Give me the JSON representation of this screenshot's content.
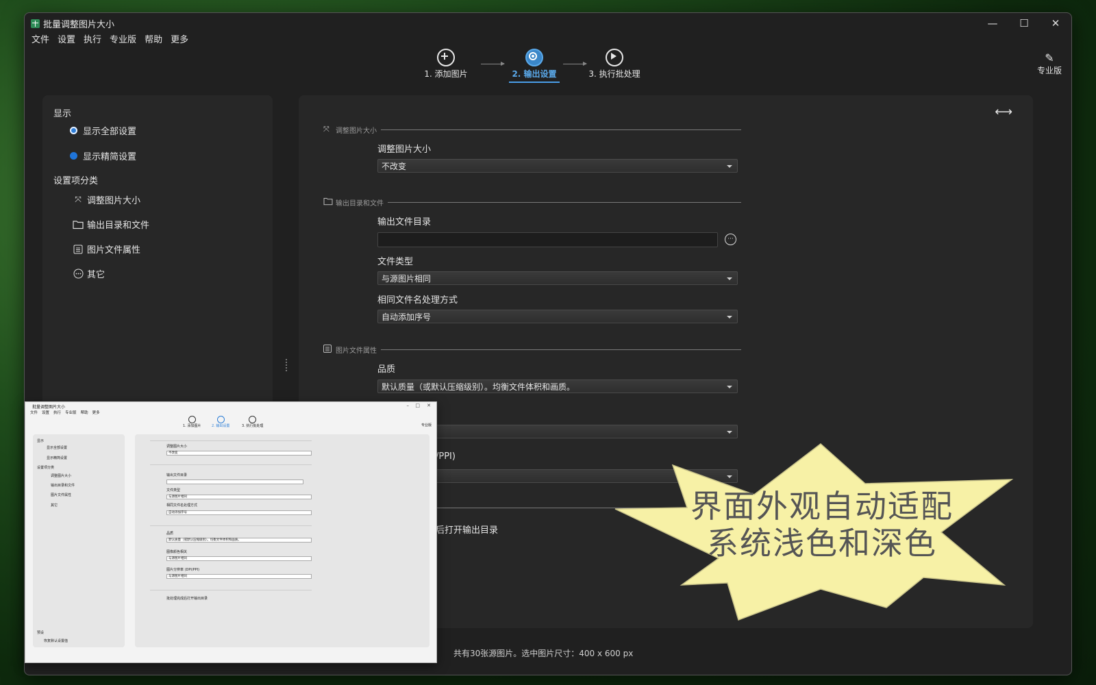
{
  "window": {
    "title": "批量调整图片大小",
    "controls": {
      "minimize": "—",
      "maximize": "☐",
      "close": "✕"
    }
  },
  "menu": [
    "文件",
    "设置",
    "执行",
    "专业版",
    "帮助",
    "更多"
  ],
  "steps": [
    {
      "label": "1. 添加图片",
      "icon": "plus-circle-icon"
    },
    {
      "label": "2. 输出设置",
      "icon": "gear-circle-icon",
      "active": true
    },
    {
      "label": "3. 执行批处理",
      "icon": "play-circle-icon"
    }
  ],
  "pro": {
    "label": "专业版",
    "icon": "pen-icon"
  },
  "sidebar": {
    "display_heading": "显示",
    "radios": [
      {
        "label": "显示全部设置",
        "selected": true
      },
      {
        "label": "显示精简设置",
        "selected": false
      }
    ],
    "category_heading": "设置项分类",
    "categories": [
      {
        "label": "调整图片大小",
        "icon": "resize-icon"
      },
      {
        "label": "输出目录和文件",
        "icon": "folder-icon"
      },
      {
        "label": "图片文件属性",
        "icon": "list-icon"
      },
      {
        "label": "其它",
        "icon": "more-circle-icon"
      }
    ]
  },
  "main": {
    "sections": [
      {
        "title": "调整图片大小",
        "icon": "resize-icon"
      },
      {
        "title": "输出目录和文件",
        "icon": "folder-icon"
      },
      {
        "title": "图片文件属性",
        "icon": "list-icon"
      }
    ],
    "resize_label": "调整图片大小",
    "resize_value": "不改变",
    "outdir_label": "输出文件目录",
    "outdir_value": "",
    "filetype_label": "文件类型",
    "filetype_value": "与源图片相同",
    "samename_label": "相同文件名处理方式",
    "samename_value": "自动添加序号",
    "quality_label": "品质",
    "quality_value": "默认质量（或默认压缩级别）。均衡文件体积和画质。",
    "ppi_fragment": "/PPI)",
    "open_dir_fragment": "后打开输出目录"
  },
  "status": "共有30张源图片。选中图片尺寸：400 x 600 px",
  "callout": {
    "line1": "界面外观自动适配",
    "line2": "系统浅色和深色",
    "color": "#f7f1a6"
  },
  "thumbnail": {
    "title": "批量调整图片大小",
    "menu": [
      "文件",
      "设置",
      "执行",
      "专业版",
      "帮助",
      "更多"
    ],
    "steps": [
      "1. 添加图片",
      "2. 输出设置",
      "3. 执行批处理"
    ],
    "pro": "专业版",
    "side": {
      "display": "显示",
      "radio1": "显示全部设置",
      "radio2": "显示精简设置",
      "category": "设置项分类",
      "cat1": "调整图片大小",
      "cat2": "输出目录和文件",
      "cat3": "图片文件属性",
      "cat4": "其它",
      "preset": "预设",
      "restore": "恢复默认设置值"
    },
    "fields": {
      "resize_label": "调整图片大小",
      "resize_value": "不改变",
      "outdir_label": "输出文件目录",
      "filetype_label": "文件类型",
      "filetype_value": "与源图片相同",
      "samename_label": "相同文件名处理方式",
      "samename_value": "自动添加序号",
      "quality_label": "品质",
      "quality_value": "默认质量（或默认压缩级别）。均衡文件体积和画质。",
      "color_label": "图像颜色相关",
      "color_value": "与源图片相同",
      "dpi_label": "图片分辨率 (DPI/PPI)",
      "dpi_value": "与源图片相同",
      "open_dir": "批处理完成后打开输出目录"
    }
  }
}
